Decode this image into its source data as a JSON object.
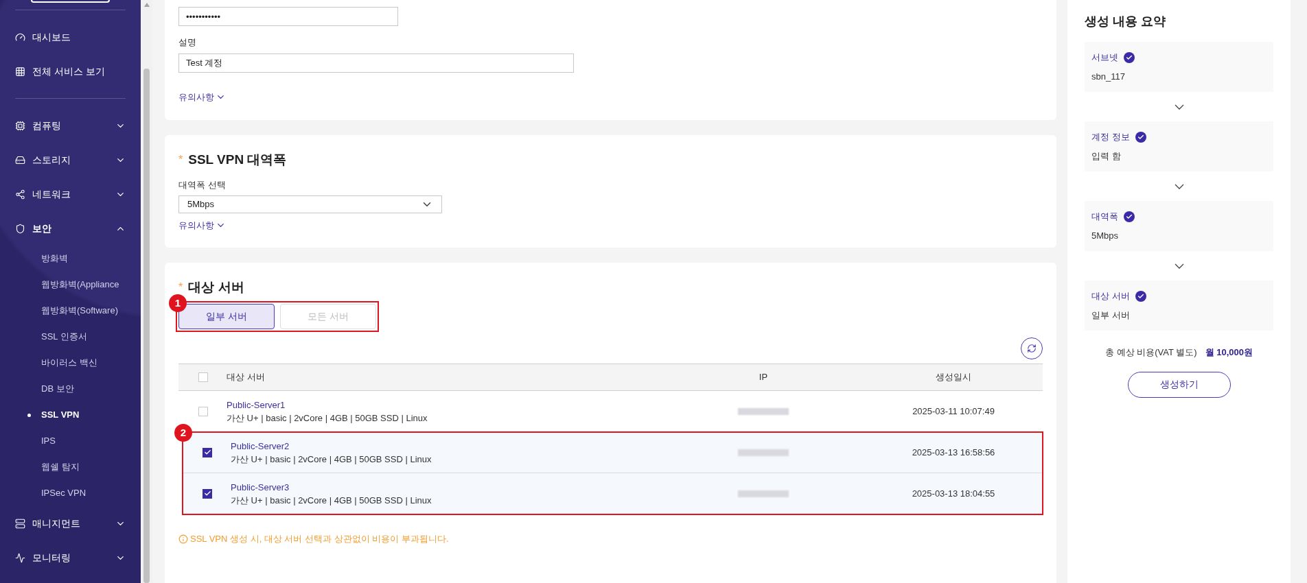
{
  "sidebar": {
    "sections": [
      {
        "items": [
          {
            "kind": "link",
            "label": "대시보드"
          },
          {
            "kind": "link",
            "label": "전체 서비스 보기"
          }
        ]
      },
      {
        "items": [
          {
            "kind": "group",
            "label": "컴퓨팅",
            "expanded": false
          },
          {
            "kind": "group",
            "label": "스토리지",
            "expanded": false
          },
          {
            "kind": "group",
            "label": "네트워크",
            "expanded": false
          },
          {
            "kind": "group",
            "label": "보안",
            "expanded": true,
            "children": [
              {
                "label": "방화벽",
                "selected": false
              },
              {
                "label": "웹방화벽(Appliance",
                "selected": false
              },
              {
                "label": "웹방화벽(Software)",
                "selected": false
              },
              {
                "label": "SSL 인증서",
                "selected": false
              },
              {
                "label": "바이러스 백신",
                "selected": false
              },
              {
                "label": "DB 보안",
                "selected": false
              },
              {
                "label": "SSL VPN",
                "selected": true
              },
              {
                "label": "IPS",
                "selected": false
              },
              {
                "label": "웹쉘 탐지",
                "selected": false
              },
              {
                "label": "IPSec VPN",
                "selected": false
              }
            ]
          },
          {
            "kind": "group",
            "label": "매니지먼트",
            "expanded": false
          },
          {
            "kind": "group",
            "label": "모니터링",
            "expanded": false
          }
        ]
      }
    ]
  },
  "account_card": {
    "password_value": "•••••••••••",
    "description_label": "설명",
    "description_value": "Test 계정",
    "notice_link": "유의사항"
  },
  "bandwidth_card": {
    "title": "SSL VPN 대역폭",
    "required_mark": "*",
    "select_label": "대역폭 선택",
    "select_value": "5Mbps",
    "notice_link": "유의사항"
  },
  "server_card": {
    "title": "대상 서버",
    "required_mark": "*",
    "scope": {
      "annotation": "1",
      "options": [
        {
          "label": "일부 서버",
          "selected": true
        },
        {
          "label": "모든 서버",
          "selected": false
        }
      ]
    },
    "table": {
      "annotation": "2",
      "columns": [
        "대상 서버",
        "IP",
        "생성일시"
      ],
      "all_checked": false,
      "rows": [
        {
          "name": "Public-Server1",
          "spec": "가산 U+ | basic | 2vCore | 4GB | 50GB SSD | Linux",
          "created": "2025-03-11 10:07:49",
          "checked": false,
          "annotated": false
        },
        {
          "name": "Public-Server2",
          "spec": "가산 U+ | basic | 2vCore | 4GB | 50GB SSD | Linux",
          "created": "2025-03-13 16:58:56",
          "checked": true,
          "annotated": true
        },
        {
          "name": "Public-Server3",
          "spec": "가산 U+ | basic | 2vCore | 4GB | 50GB SSD | Linux",
          "created": "2025-03-13 18:04:55",
          "checked": true,
          "annotated": true
        }
      ]
    },
    "note": "SSL VPN 생성 시, 대상 서버 선택과 상관없이 비용이 부과됩니다."
  },
  "summary": {
    "title": "생성 내용 요약",
    "steps": [
      {
        "label": "서브넷",
        "done": true,
        "value": "sbn_117"
      },
      {
        "label": "계정 정보",
        "done": true,
        "value": "입력 함"
      },
      {
        "label": "대역폭",
        "done": true,
        "value": "5Mbps"
      },
      {
        "label": "대상 서버",
        "done": true,
        "value": "일부 서버"
      }
    ],
    "total_label": "총 예상 비용(VAT 별도)",
    "total_value": "월 10,000원",
    "create_button": "생성하기"
  }
}
